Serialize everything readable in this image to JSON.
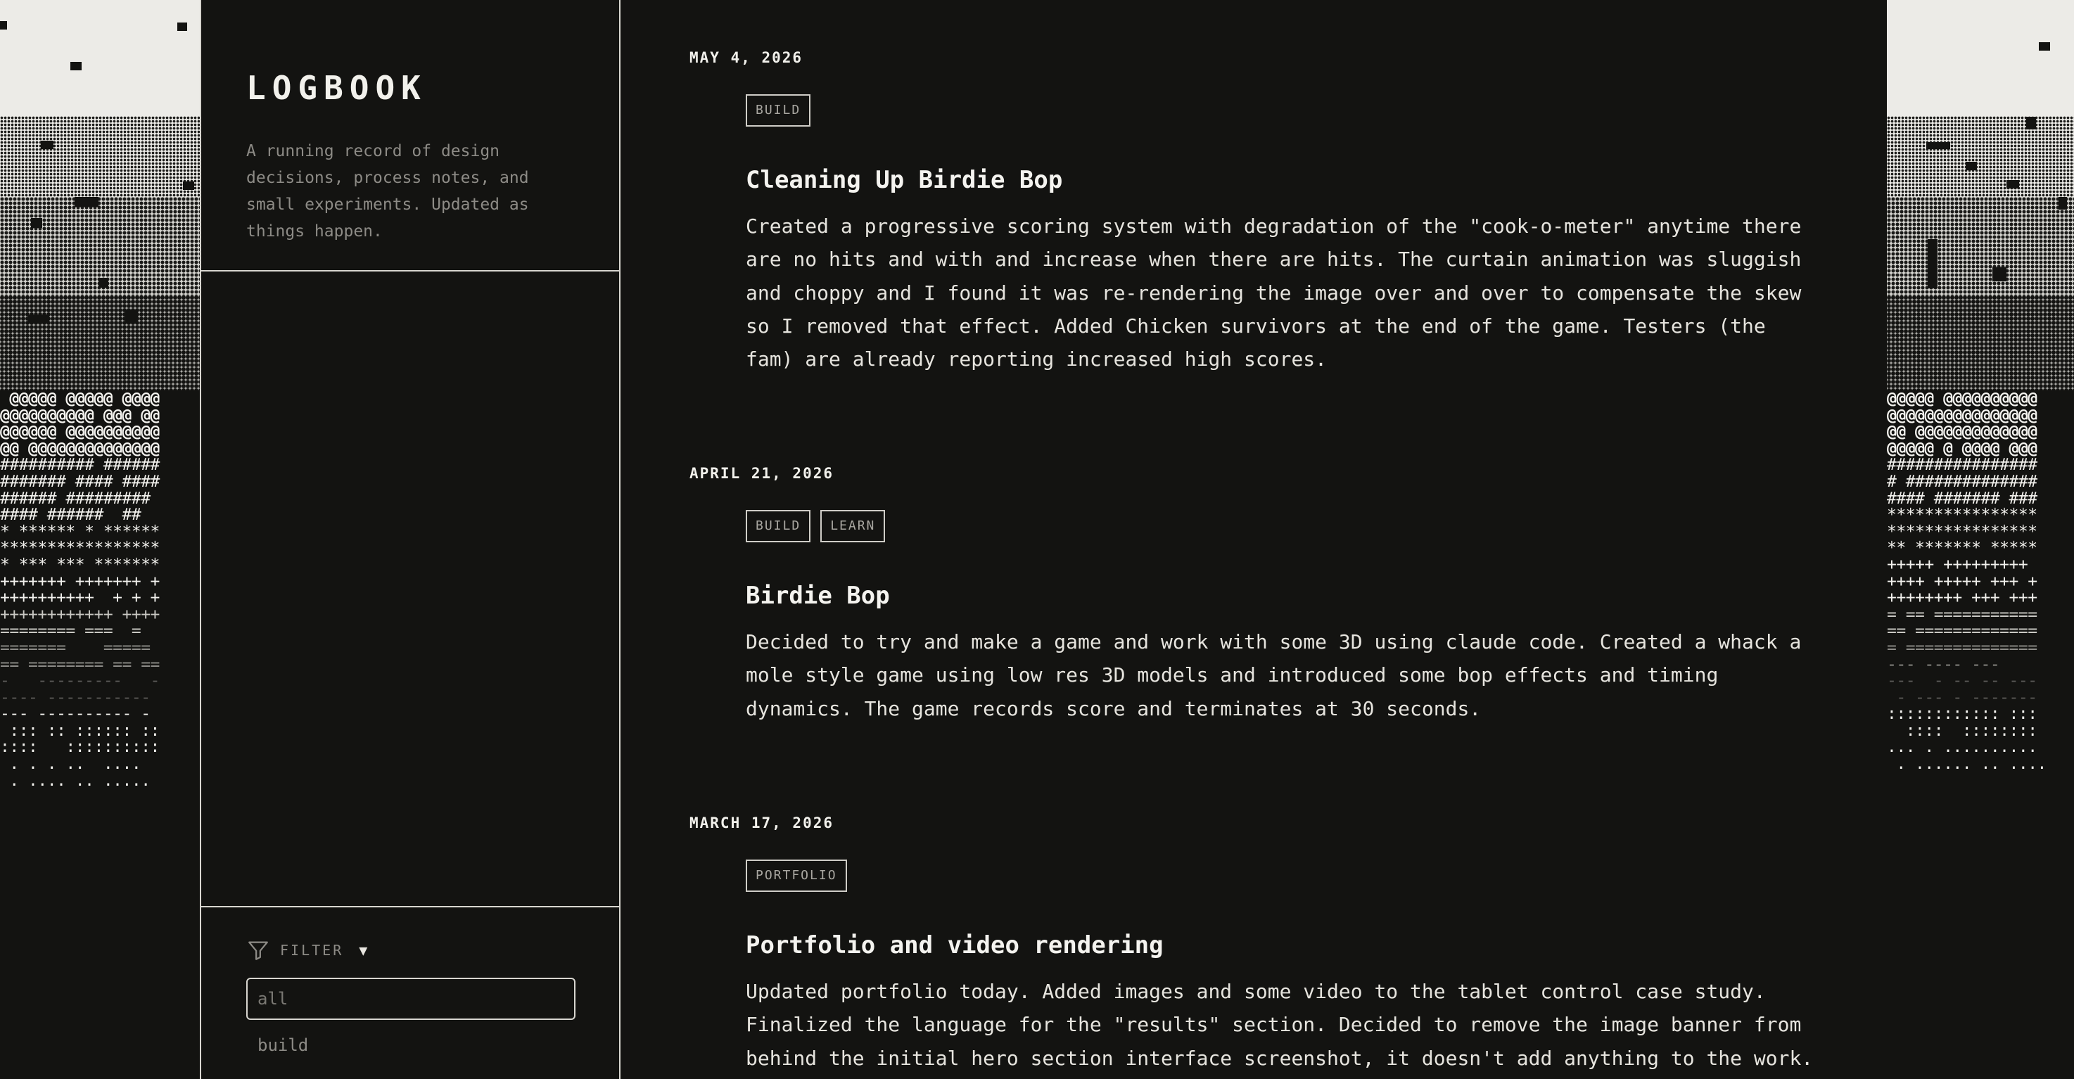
{
  "sidebar": {
    "title": "LOGBOOK",
    "tagline": "A running record of design decisions, process notes, and small experiments. Updated as things happen.",
    "filter": {
      "label": "FILTER",
      "caret": "▼",
      "input_placeholder": "all",
      "options": [
        "build"
      ]
    }
  },
  "entries": [
    {
      "date": "MAY 4, 2026",
      "tags": [
        "BUILD"
      ],
      "title": "Cleaning Up Birdie Bop",
      "body": "Created a progressive scoring system with degradation of the \"cook-o-meter\" anytime there are no hits and with and increase when there are hits. The curtain animation was sluggish and choppy and I found it was re-rendering the image over and over to compensate the skew so I removed that effect. Added Chicken survivors at the end of the game. Testers (the fam) are already reporting increased high scores."
    },
    {
      "date": "APRIL 21, 2026",
      "tags": [
        "BUILD",
        "LEARN"
      ],
      "title": "Birdie Bop",
      "body": "Decided to try and make a game and work with some 3D using claude code. Created a whack a mole style game using low res 3D models and introduced some bop effects and timing dynamics. The game records score and terminates at 30 seconds."
    },
    {
      "date": "MARCH 17, 2026",
      "tags": [
        "PORTFOLIO"
      ],
      "title": "Portfolio and video rendering",
      "body": "Updated portfolio today. Added images and some video to the tablet control case study. Finalized the language for the \"results\" section. Decided to remove the image banner from behind the initial hero section interface screenshot, it doesn't add anything to the work."
    }
  ],
  "art": {
    "left_ascii": [
      " @@@@@ @@@@@ @@@@",
      "@@@@@@@@@@ @@@ @@",
      "@@@@@@ @@@@@@@@@@",
      "@@ @@@@@@@@@@@@@@",
      "########## ######",
      "####### #### ####",
      "###### ######### ",
      "#### ######  ##  ",
      "* ****** * ******",
      "*****************",
      "* *** *** *******",
      "+++++++ +++++++ +",
      "++++++++++  + + +",
      "++++++++++++ ++++",
      "======== ===  =  ",
      "=======    ===== ",
      "== ======== == ==",
      "-   ---------   -",
      "---- -----------",
      "--- ---------- - ",
      " ::: :: :::::: ::",
      "::::   ::::::::::",
      " . . . ..  ....  ",
      " . .... .. .....  "
    ],
    "right_ascii": [
      "@@@@@ @@@@@@@@@@",
      "@@@@@@@@@@@@@@@@",
      "@@ @@@@@@@@@@@@@",
      "@@@@@ @ @@@@ @@@",
      "################",
      "# ##############",
      "#### ####### ###",
      "****************",
      "****************",
      "** ******* *****",
      "+++++ +++++++++ ",
      "++++ +++++ +++ +",
      "++++++++ +++ +++",
      "= == ===========",
      "== =============",
      "= ==============",
      "--- ---- ---    ",
      "---  - -- -- ---",
      " - --- - -------",
      ":::::::::::: :::",
      "  ::::  ::::::::",
      "... . ..........",
      " . ...... .. ...."
    ]
  }
}
